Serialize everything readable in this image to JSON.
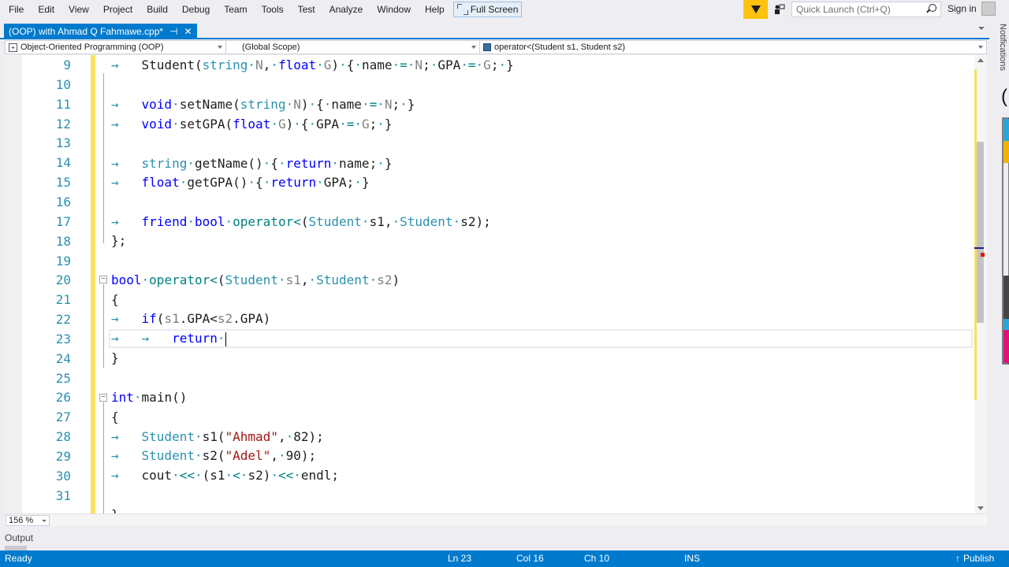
{
  "menubar": {
    "items": [
      "File",
      "Edit",
      "View",
      "Project",
      "Build",
      "Debug",
      "Team",
      "Tools",
      "Test",
      "Analyze",
      "Window",
      "Help"
    ],
    "fullscreen_label": "Full Screen",
    "quick_launch_placeholder": "Quick Launch (Ctrl+Q)",
    "sign_in": "Sign in",
    "filter_color": "#ffc20e"
  },
  "tab": {
    "title": "(OOP) with Ahmad Q Fahmawe.cpp*",
    "pin_icon": "⊣",
    "close_icon": "✕"
  },
  "navbar": {
    "project": "Object-Oriented Programming (OOP)",
    "scope": "(Global Scope)",
    "member": "operator<(Student s1, Student s2)"
  },
  "side_panel": {
    "notifications": "Notifications"
  },
  "editor": {
    "line_numbers": [
      "9",
      "10",
      "11",
      "12",
      "13",
      "14",
      "15",
      "16",
      "17",
      "18",
      "19",
      "20",
      "21",
      "22",
      "23",
      "24",
      "25",
      "26",
      "27",
      "28",
      "29",
      "30",
      "31"
    ],
    "current_line": "23"
  },
  "bottom": {
    "zoom_level": "156 %",
    "output_label": "Output"
  },
  "status": {
    "ready": "Ready",
    "line": "Ln 23",
    "col": "Col 16",
    "ch": "Ch 10",
    "mode": "INS",
    "publish": "Publish",
    "accent": "#007acc"
  }
}
